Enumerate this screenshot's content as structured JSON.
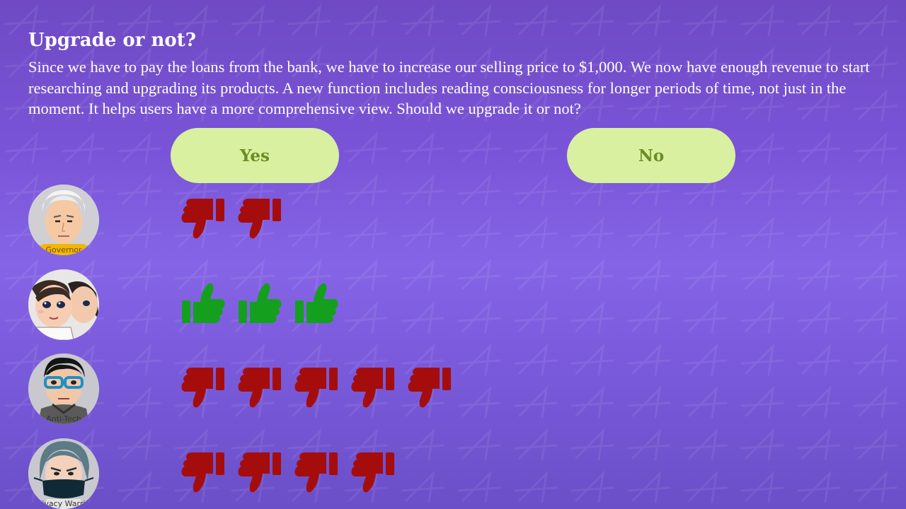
{
  "question": {
    "title": "Upgrade or not?",
    "text": "Since we have to pay the loans from the bank, we have to increase our selling price to $1,000. We now have enough revenue to start researching and upgrading its products. A new function includes reading consciousness for longer periods of time, not just in the moment. It helps users have a more comprehensive view.  Should we upgrade it or not?"
  },
  "choices": {
    "yes_label": "Yes",
    "no_label": "No"
  },
  "colors": {
    "thumbs_down": "#a50d0d",
    "thumbs_up": "#14a01e",
    "button_bg": "#d9f0a0",
    "button_text": "#6b8e23"
  },
  "players": [
    {
      "name": "Governor",
      "avatar_icon": "governor-avatar-icon",
      "vote": "down",
      "vote_count": 2
    },
    {
      "name": "Couple",
      "avatar_icon": "couple-avatar-icon",
      "vote": "up",
      "vote_count": 3
    },
    {
      "name": "Anti-Tech",
      "avatar_icon": "anti-tech-avatar-icon",
      "vote": "down",
      "vote_count": 5
    },
    {
      "name": "Privacy Warrior",
      "avatar_icon": "privacy-warrior-avatar-icon",
      "vote": "down",
      "vote_count": 4
    }
  ]
}
